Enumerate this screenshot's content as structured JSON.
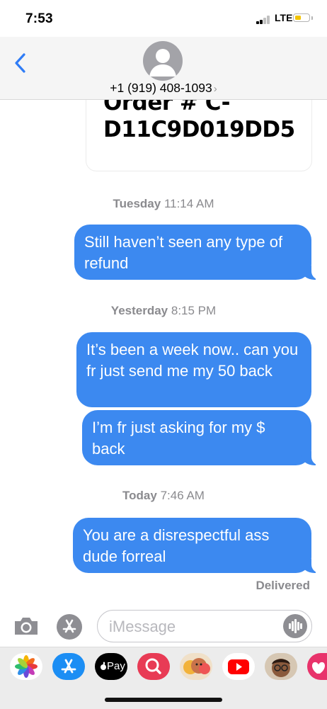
{
  "status_bar": {
    "time": "7:53",
    "network": "LTE",
    "battery_color": "#f2c300"
  },
  "header": {
    "back_icon": "chevron-left-icon",
    "avatar_icon": "person-icon",
    "contact": "+1 (919) 408-1093",
    "contact_chevron": "›"
  },
  "image_message": {
    "line1": "Order # C-",
    "line2": "D11C9D019DD5"
  },
  "messages": [
    {
      "timestamp_day": "Tuesday",
      "timestamp_time": "11:14 AM",
      "bubbles": [
        "Still haven’t seen any type of refund"
      ]
    },
    {
      "timestamp_day": "Yesterday",
      "timestamp_time": "8:15 PM",
      "bubbles": [
        "It’s been a week now.. can you fr just send me my 50 back",
        "I’m fr just asking for my $ back"
      ]
    },
    {
      "timestamp_day": "Today",
      "timestamp_time": "7:46 AM",
      "bubbles": [
        "You are a disrespectful ass dude forreal"
      ]
    }
  ],
  "delivered": "Delivered",
  "input": {
    "placeholder": "iMessage",
    "camera_icon": "camera-icon",
    "apps_icon": "app-store-icon",
    "audio_icon": "waveform-icon"
  },
  "colors": {
    "bubble": "#3c89f0",
    "header_bg": "#f5f5f5",
    "timestamp": "#8a8a8e"
  },
  "tray": {
    "apps": [
      "photos-icon",
      "app-store-icon",
      "apple-pay-icon",
      "web-search-icon",
      "memoji-stickers-icon",
      "youtube-icon",
      "memoji-icon",
      "heart-app-icon"
    ],
    "apple_pay_label": "Pay"
  }
}
